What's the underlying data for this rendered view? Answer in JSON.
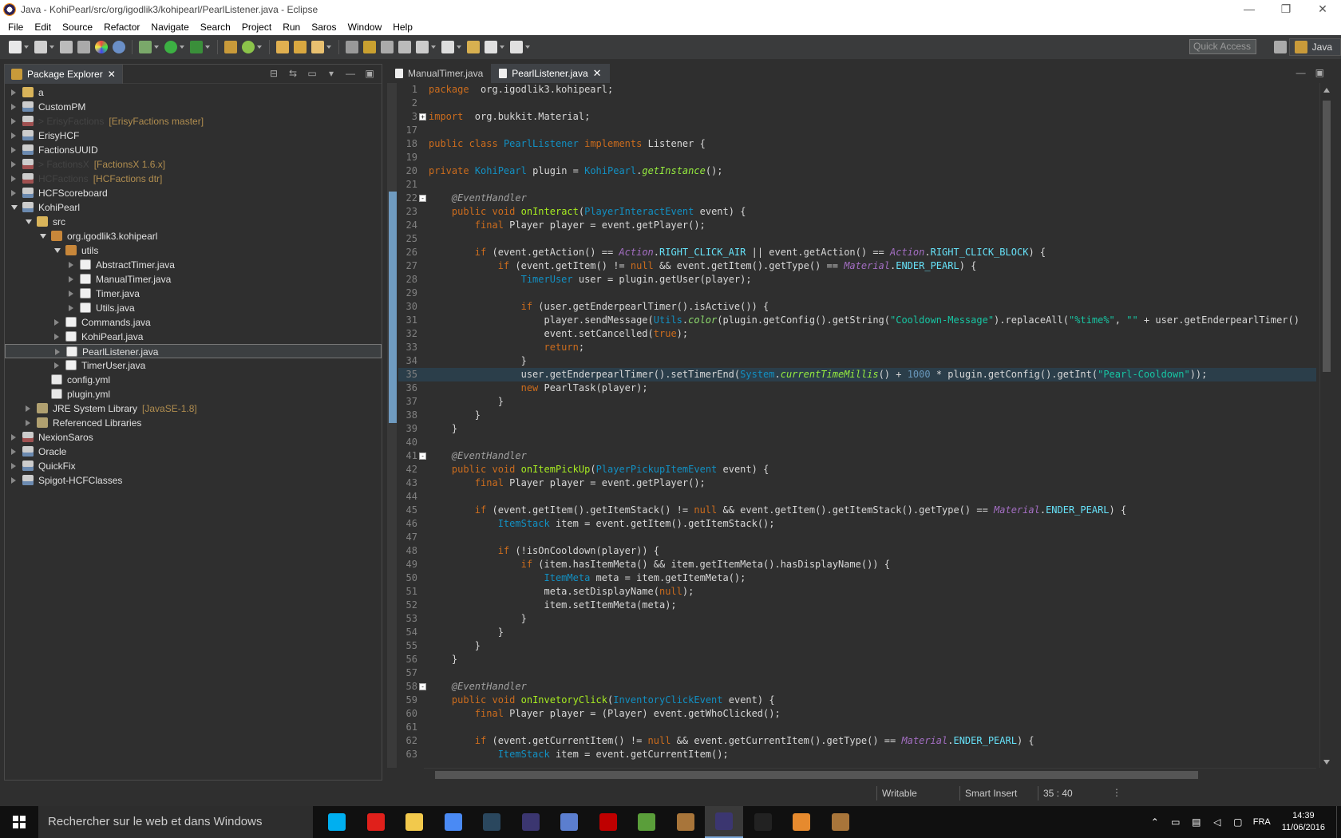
{
  "window": {
    "title": "Java - KohiPearl/src/org/igodlik3/kohipearl/PearlListener.java - Eclipse",
    "controls": [
      "—",
      "❐",
      "✕"
    ]
  },
  "menu": [
    "File",
    "Edit",
    "Source",
    "Refactor",
    "Navigate",
    "Search",
    "Project",
    "Run",
    "Saros",
    "Window",
    "Help"
  ],
  "toolbar": {
    "quick_access_placeholder": "Quick Access",
    "perspective_label": "Java"
  },
  "explorer": {
    "tab_label": "Package Explorer",
    "tree": [
      {
        "label": "a",
        "depth": 0,
        "icon": "folder",
        "twisty": "closed"
      },
      {
        "label": "CustomPM",
        "depth": 0,
        "icon": "project",
        "twisty": "closed"
      },
      {
        "label": "> ErisyFactions",
        "deco": "[ErisyFactions master]",
        "depth": 0,
        "icon": "project-git",
        "twisty": "closed",
        "dim": true
      },
      {
        "label": "ErisyHCF",
        "depth": 0,
        "icon": "project",
        "twisty": "closed"
      },
      {
        "label": "FactionsUUID",
        "depth": 0,
        "icon": "project",
        "twisty": "closed"
      },
      {
        "label": "> FactionsX",
        "deco": "[FactionsX 1.6.x]",
        "depth": 0,
        "icon": "project-git",
        "twisty": "closed",
        "dim": true
      },
      {
        "label": "HCFactions",
        "deco": "[HCFactions dtr]",
        "depth": 0,
        "icon": "project-git",
        "twisty": "closed",
        "dim": true
      },
      {
        "label": "HCFScoreboard",
        "depth": 0,
        "icon": "project",
        "twisty": "closed"
      },
      {
        "label": "KohiPearl",
        "depth": 0,
        "icon": "project",
        "twisty": "open"
      },
      {
        "label": "src",
        "depth": 1,
        "icon": "folder",
        "twisty": "open"
      },
      {
        "label": "org.igodlik3.kohipearl",
        "depth": 2,
        "icon": "package",
        "twisty": "open"
      },
      {
        "label": "utils",
        "depth": 3,
        "icon": "package",
        "twisty": "open"
      },
      {
        "label": "AbstractTimer.java",
        "depth": 4,
        "icon": "java",
        "twisty": "closed"
      },
      {
        "label": "ManualTimer.java",
        "depth": 4,
        "icon": "java",
        "twisty": "closed"
      },
      {
        "label": "Timer.java",
        "depth": 4,
        "icon": "java",
        "twisty": "closed"
      },
      {
        "label": "Utils.java",
        "depth": 4,
        "icon": "java",
        "twisty": "closed"
      },
      {
        "label": "Commands.java",
        "depth": 3,
        "icon": "java",
        "twisty": "closed"
      },
      {
        "label": "KohiPearl.java",
        "depth": 3,
        "icon": "java",
        "twisty": "closed"
      },
      {
        "label": "PearlListener.java",
        "depth": 3,
        "icon": "java",
        "twisty": "closed",
        "selected": true
      },
      {
        "label": "TimerUser.java",
        "depth": 3,
        "icon": "java",
        "twisty": "closed"
      },
      {
        "label": "config.yml",
        "depth": 2,
        "icon": "file",
        "twisty": "none"
      },
      {
        "label": "plugin.yml",
        "depth": 2,
        "icon": "file",
        "twisty": "none"
      },
      {
        "label": "JRE System Library",
        "deco": "[JavaSE-1.8]",
        "depth": 1,
        "icon": "lib",
        "twisty": "closed"
      },
      {
        "label": "Referenced Libraries",
        "depth": 1,
        "icon": "lib",
        "twisty": "closed"
      },
      {
        "label": "NexionSaros",
        "depth": 0,
        "icon": "project-git",
        "twisty": "closed"
      },
      {
        "label": "Oracle",
        "depth": 0,
        "icon": "project",
        "twisty": "closed"
      },
      {
        "label": "QuickFix",
        "depth": 0,
        "icon": "project",
        "twisty": "closed"
      },
      {
        "label": "Spigot-HCFClasses",
        "depth": 0,
        "icon": "project",
        "twisty": "closed"
      }
    ]
  },
  "editor": {
    "tabs": [
      {
        "label": "ManualTimer.java",
        "active": false
      },
      {
        "label": "PearlListener.java",
        "active": true
      }
    ],
    "current_line": 35,
    "lines": [
      {
        "n": "1",
        "t": [
          [
            "kw",
            "package"
          ],
          [
            "",
            "  org.igodlik3.kohipearl;"
          ]
        ]
      },
      {
        "n": "2",
        "t": []
      },
      {
        "n": "3",
        "fold": "+",
        "t": [
          [
            "kw",
            "import"
          ],
          [
            "",
            "  org.bukkit.Material;"
          ]
        ]
      },
      {
        "n": "17",
        "t": []
      },
      {
        "n": "18",
        "t": [
          [
            "kw",
            "public class"
          ],
          [
            "",
            " "
          ],
          [
            "ty",
            "PearlListener"
          ],
          [
            "",
            " "
          ],
          [
            "kw",
            "implements"
          ],
          [
            "",
            " Listener {"
          ]
        ]
      },
      {
        "n": "19",
        "t": []
      },
      {
        "n": "20",
        "t": [
          [
            "kw",
            "private"
          ],
          [
            "",
            " "
          ],
          [
            "ty",
            "KohiPearl"
          ],
          [
            "",
            " plugin = "
          ],
          [
            "ty",
            "KohiPearl"
          ],
          [
            "",
            "."
          ],
          [
            "mi",
            "getInstance"
          ],
          [
            "",
            "();"
          ]
        ]
      },
      {
        "n": "21",
        "t": []
      },
      {
        "n": "22",
        "fold": "-",
        "t": [
          [
            "",
            "    "
          ],
          [
            "an",
            "@EventHandler"
          ]
        ]
      },
      {
        "n": "23",
        "t": [
          [
            "",
            "    "
          ],
          [
            "kw",
            "public void"
          ],
          [
            "",
            " "
          ],
          [
            "fn",
            "onInteract"
          ],
          [
            "",
            "("
          ],
          [
            "ty",
            "PlayerInteractEvent"
          ],
          [
            "",
            " event) {"
          ]
        ]
      },
      {
        "n": "24",
        "t": [
          [
            "",
            "        "
          ],
          [
            "kw",
            "final"
          ],
          [
            "",
            " Player player = event.getPlayer();"
          ]
        ]
      },
      {
        "n": "25",
        "t": []
      },
      {
        "n": "26",
        "t": [
          [
            "",
            "        "
          ],
          [
            "kw",
            "if"
          ],
          [
            "",
            " (event.getAction() == "
          ],
          [
            "it",
            "Action"
          ],
          [
            "",
            "."
          ],
          [
            "fi",
            "RIGHT_CLICK_AIR"
          ],
          [
            "",
            " || event.getAction() == "
          ],
          [
            "it",
            "Action"
          ],
          [
            "",
            "."
          ],
          [
            "fi",
            "RIGHT_CLICK_BLOCK"
          ],
          [
            "",
            ") {"
          ]
        ]
      },
      {
        "n": "27",
        "t": [
          [
            "",
            "            "
          ],
          [
            "kw",
            "if"
          ],
          [
            "",
            " (event.getItem() != "
          ],
          [
            "kw",
            "null"
          ],
          [
            "",
            " && event.getItem().getType() == "
          ],
          [
            "it",
            "Material"
          ],
          [
            "",
            "."
          ],
          [
            "fi",
            "ENDER_PEARL"
          ],
          [
            "",
            ") {"
          ]
        ]
      },
      {
        "n": "28",
        "t": [
          [
            "",
            "                "
          ],
          [
            "ty",
            "TimerUser"
          ],
          [
            "",
            " user = plugin.getUser(player);"
          ]
        ]
      },
      {
        "n": "29",
        "t": []
      },
      {
        "n": "30",
        "t": [
          [
            "",
            "                "
          ],
          [
            "kw",
            "if"
          ],
          [
            "",
            " (user.getEnderpearlTimer().isActive()) {"
          ]
        ]
      },
      {
        "n": "31",
        "t": [
          [
            "",
            "                    player.sendMessage("
          ],
          [
            "ty",
            "Utils"
          ],
          [
            "",
            "."
          ],
          [
            "fl",
            "color"
          ],
          [
            "",
            "(plugin.getConfig().getString("
          ],
          [
            "st",
            "\"Cooldown-Message\""
          ],
          [
            "",
            ").replaceAll("
          ],
          [
            "st",
            "\"%time%\""
          ],
          [
            "",
            ", "
          ],
          [
            "st",
            "\"\""
          ],
          [
            "",
            " + user.getEnderpearlTimer()"
          ]
        ]
      },
      {
        "n": "32",
        "t": [
          [
            "",
            "                    event.setCancelled("
          ],
          [
            "kw",
            "true"
          ],
          [
            "",
            ");"
          ]
        ]
      },
      {
        "n": "33",
        "t": [
          [
            "",
            "                    "
          ],
          [
            "kw",
            "return"
          ],
          [
            "",
            ";"
          ]
        ]
      },
      {
        "n": "34",
        "t": [
          [
            "",
            "                }"
          ]
        ]
      },
      {
        "n": "35",
        "t": [
          [
            "",
            "                user.getEnderpearlTimer().setTimerEnd("
          ],
          [
            "ty",
            "System"
          ],
          [
            "",
            "."
          ],
          [
            "mi",
            "currentTimeMillis"
          ],
          [
            "",
            "() + "
          ],
          [
            "nu",
            "1000"
          ],
          [
            "",
            " * plugin.getConfig().getInt("
          ],
          [
            "st",
            "\"Pearl-Cooldown\""
          ],
          [
            "",
            "));"
          ]
        ]
      },
      {
        "n": "36",
        "t": [
          [
            "",
            "                "
          ],
          [
            "kw",
            "new"
          ],
          [
            "",
            " PearlTask(player);"
          ]
        ]
      },
      {
        "n": "37",
        "t": [
          [
            "",
            "            }"
          ]
        ]
      },
      {
        "n": "38",
        "t": [
          [
            "",
            "        }"
          ]
        ]
      },
      {
        "n": "39",
        "t": [
          [
            "",
            "    }"
          ]
        ]
      },
      {
        "n": "40",
        "t": []
      },
      {
        "n": "41",
        "fold": "-",
        "t": [
          [
            "",
            "    "
          ],
          [
            "an",
            "@EventHandler"
          ]
        ]
      },
      {
        "n": "42",
        "t": [
          [
            "",
            "    "
          ],
          [
            "kw",
            "public void"
          ],
          [
            "",
            " "
          ],
          [
            "fn",
            "onItemPickUp"
          ],
          [
            "",
            "("
          ],
          [
            "ty",
            "PlayerPickupItemEvent"
          ],
          [
            "",
            " event) {"
          ]
        ]
      },
      {
        "n": "43",
        "t": [
          [
            "",
            "        "
          ],
          [
            "kw",
            "final"
          ],
          [
            "",
            " Player player = event.getPlayer();"
          ]
        ]
      },
      {
        "n": "44",
        "t": []
      },
      {
        "n": "45",
        "t": [
          [
            "",
            "        "
          ],
          [
            "kw",
            "if"
          ],
          [
            "",
            " (event.getItem().getItemStack() != "
          ],
          [
            "kw",
            "null"
          ],
          [
            "",
            " && event.getItem().getItemStack().getType() == "
          ],
          [
            "it",
            "Material"
          ],
          [
            "",
            "."
          ],
          [
            "fi",
            "ENDER_PEARL"
          ],
          [
            "",
            ") {"
          ]
        ]
      },
      {
        "n": "46",
        "t": [
          [
            "",
            "            "
          ],
          [
            "ty",
            "ItemStack"
          ],
          [
            "",
            " item = event.getItem().getItemStack();"
          ]
        ]
      },
      {
        "n": "47",
        "t": []
      },
      {
        "n": "48",
        "t": [
          [
            "",
            "            "
          ],
          [
            "kw",
            "if"
          ],
          [
            "",
            " (!isOnCooldown(player)) {"
          ]
        ]
      },
      {
        "n": "49",
        "t": [
          [
            "",
            "                "
          ],
          [
            "kw",
            "if"
          ],
          [
            "",
            " (item.hasItemMeta() && item.getItemMeta().hasDisplayName()) {"
          ]
        ]
      },
      {
        "n": "50",
        "t": [
          [
            "",
            "                    "
          ],
          [
            "ty",
            "ItemMeta"
          ],
          [
            "",
            " meta = item.getItemMeta();"
          ]
        ]
      },
      {
        "n": "51",
        "t": [
          [
            "",
            "                    meta.setDisplayName("
          ],
          [
            "kw",
            "null"
          ],
          [
            "",
            ");"
          ]
        ]
      },
      {
        "n": "52",
        "t": [
          [
            "",
            "                    item.setItemMeta(meta);"
          ]
        ]
      },
      {
        "n": "53",
        "t": [
          [
            "",
            "                }"
          ]
        ]
      },
      {
        "n": "54",
        "t": [
          [
            "",
            "            }"
          ]
        ]
      },
      {
        "n": "55",
        "t": [
          [
            "",
            "        }"
          ]
        ]
      },
      {
        "n": "56",
        "t": [
          [
            "",
            "    }"
          ]
        ]
      },
      {
        "n": "57",
        "t": []
      },
      {
        "n": "58",
        "fold": "-",
        "t": [
          [
            "",
            "    "
          ],
          [
            "an",
            "@EventHandler"
          ]
        ]
      },
      {
        "n": "59",
        "t": [
          [
            "",
            "    "
          ],
          [
            "kw",
            "public void"
          ],
          [
            "",
            " "
          ],
          [
            "fn",
            "onInvetoryClick"
          ],
          [
            "",
            "("
          ],
          [
            "ty",
            "InventoryClickEvent"
          ],
          [
            "",
            " event) {"
          ]
        ]
      },
      {
        "n": "60",
        "t": [
          [
            "",
            "        "
          ],
          [
            "kw",
            "final"
          ],
          [
            "",
            " Player player = (Player) event.getWhoClicked();"
          ]
        ]
      },
      {
        "n": "61",
        "t": []
      },
      {
        "n": "62",
        "t": [
          [
            "",
            "        "
          ],
          [
            "kw",
            "if"
          ],
          [
            "",
            " (event.getCurrentItem() != "
          ],
          [
            "kw",
            "null"
          ],
          [
            "",
            " && event.getCurrentItem().getType() == "
          ],
          [
            "it",
            "Material"
          ],
          [
            "",
            "."
          ],
          [
            "fi",
            "ENDER_PEARL"
          ],
          [
            "",
            ") {"
          ]
        ]
      },
      {
        "n": "63",
        "t": [
          [
            "",
            "            "
          ],
          [
            "ty",
            "ItemStack"
          ],
          [
            "",
            " item = event.getCurrentItem();"
          ]
        ]
      }
    ]
  },
  "status": {
    "writable": "Writable",
    "insert_mode": "Smart Insert",
    "position": "35 : 40"
  },
  "taskbar": {
    "search_placeholder": "Rechercher sur le web et dans Windows",
    "apps": [
      {
        "name": "skype",
        "color": "#00aff0"
      },
      {
        "name": "opera",
        "color": "#e0201b"
      },
      {
        "name": "explorer",
        "color": "#f2c94c"
      },
      {
        "name": "chrome",
        "color": "#4a8af4"
      },
      {
        "name": "steam",
        "color": "#2a475e"
      },
      {
        "name": "eclipse",
        "color": "#3b3670"
      },
      {
        "name": "network",
        "color": "#5b7ecf"
      },
      {
        "name": "filezilla",
        "color": "#bf0000"
      },
      {
        "name": "minecraft",
        "color": "#5a9e3a"
      },
      {
        "name": "package",
        "color": "#a8753a"
      },
      {
        "name": "eclipse-active",
        "color": "#3b3670"
      },
      {
        "name": "terminal",
        "color": "#222"
      },
      {
        "name": "sublime",
        "color": "#e68a2e"
      },
      {
        "name": "package2",
        "color": "#a8753a"
      }
    ],
    "language": "FRA",
    "time": "14:39",
    "date": "11/06/2016"
  }
}
